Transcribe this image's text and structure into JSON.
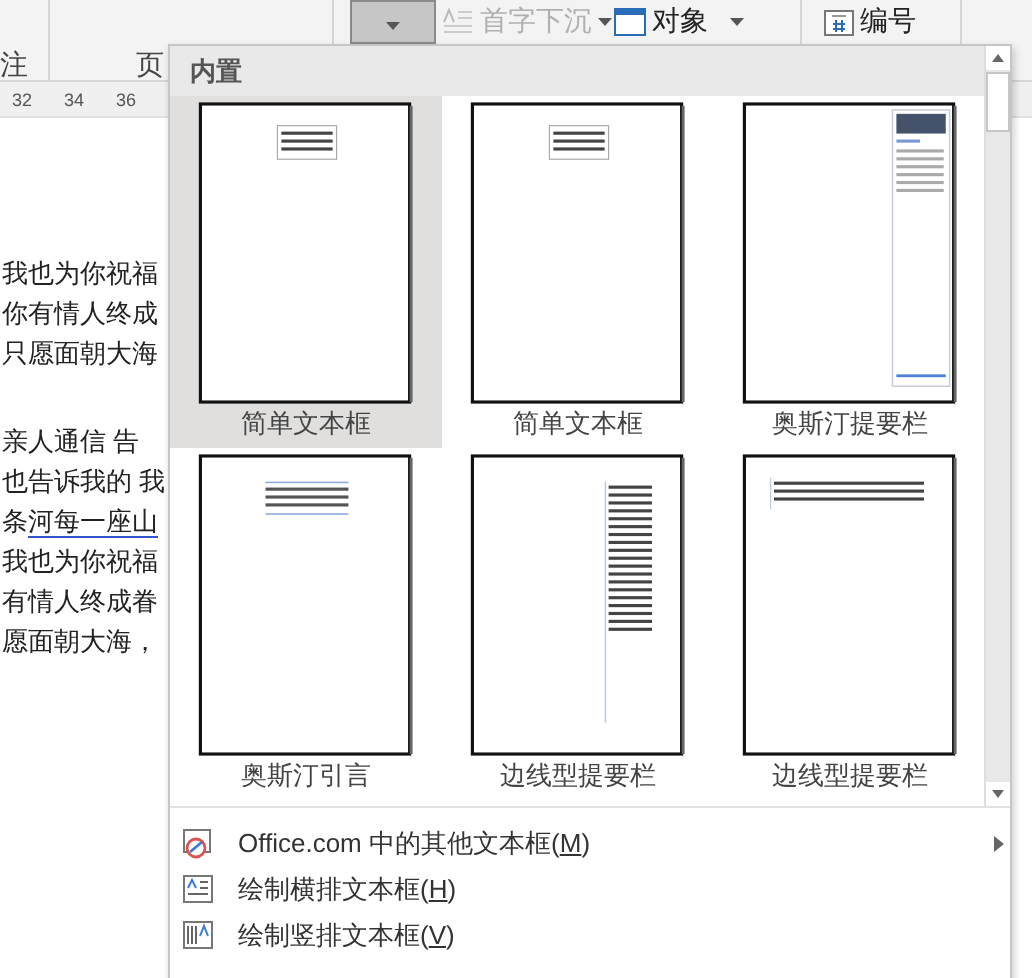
{
  "ribbon": {
    "group_labels": [
      "注",
      "页"
    ],
    "textbox_button": {
      "selected": true
    },
    "drop_cap": {
      "label": "首字下沉",
      "disabled": true
    },
    "object": {
      "label": "对象"
    },
    "numbering": {
      "label": "编号"
    }
  },
  "ruler": {
    "numbers": [
      "32",
      "34",
      "36"
    ]
  },
  "document": {
    "paragraphs": [
      {
        "lines": [
          {
            "text": "我也为你祝福"
          },
          {
            "text": "你有情人终成"
          },
          {
            "text": "只愿面朝大海"
          }
        ]
      },
      {
        "lines": [
          {
            "text": "亲人通信 告"
          },
          {
            "text": "也告诉我的 我"
          },
          {
            "text": "条",
            "marked": "河每一座山"
          },
          {
            "text": "我也为你祝福"
          },
          {
            "text": "有情人终成眷"
          },
          {
            "text": "愿面朝大海，"
          }
        ]
      }
    ]
  },
  "textbox_menu": {
    "section_title": "内置",
    "gallery": [
      {
        "label": "简单文本框",
        "kind": "simple",
        "selected": true
      },
      {
        "label": "简单文本框",
        "kind": "simple",
        "selected": false
      },
      {
        "label": "奥斯汀提要栏",
        "kind": "sidebar",
        "selected": false
      },
      {
        "label": "奥斯汀引言",
        "kind": "quote",
        "selected": false
      },
      {
        "label": "边线型提要栏",
        "kind": "line-sidebar",
        "selected": false
      },
      {
        "label": "边线型提要栏",
        "kind": "line-quote",
        "selected": false
      }
    ],
    "commands": [
      {
        "kind": "online",
        "before": "Office.com 中的其他文本框(",
        "key": "M",
        "after": ")",
        "has_submenu": true
      },
      {
        "kind": "horizontal",
        "before": "绘制横排文本框(",
        "key": "H",
        "after": ")",
        "has_submenu": false
      },
      {
        "kind": "vertical",
        "before": "绘制竖排文本框(",
        "key": "V",
        "after": ")",
        "has_submenu": false
      }
    ]
  }
}
